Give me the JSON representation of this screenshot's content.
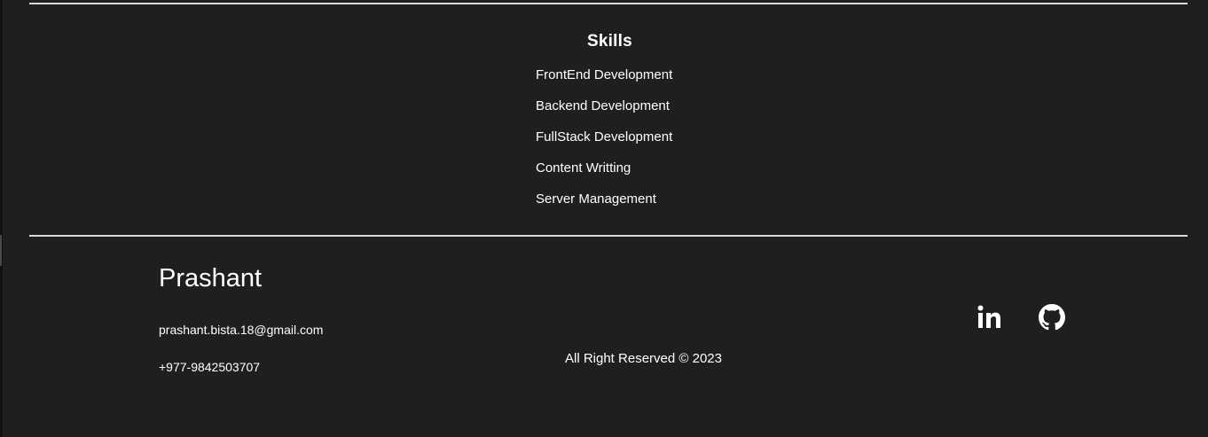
{
  "skills": {
    "title": "Skills",
    "items": [
      {
        "label": "FrontEnd Development"
      },
      {
        "label": "Backend Development"
      },
      {
        "label": "FullStack Development"
      },
      {
        "label": "Content Writting"
      },
      {
        "label": "Server Management"
      }
    ]
  },
  "footer": {
    "name": "Prashant",
    "email": "prashant.bista.18@gmail.com",
    "phone": "+977-9842503707",
    "copyright": "All Right Reserved © 2023",
    "social": [
      {
        "icon": "linkedin-icon"
      },
      {
        "icon": "github-icon"
      }
    ]
  },
  "colors": {
    "background": "#1f1f1f",
    "text": "#ffffff",
    "divider": "#d9d9d9"
  }
}
